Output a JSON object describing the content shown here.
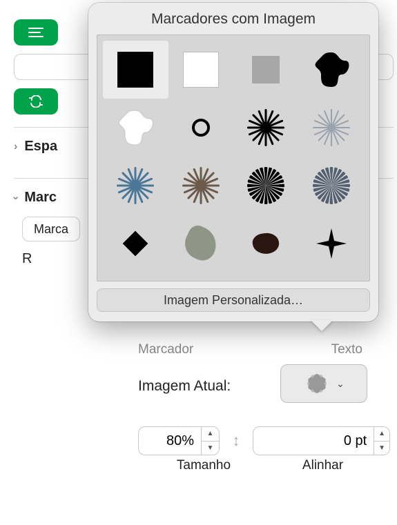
{
  "sidebar": {
    "spacing_label_partial": "Espa",
    "bullets_label_partial": "Marc",
    "bullet_type_partial": "Marca",
    "recent_partial": "R"
  },
  "popover": {
    "title": "Marcadores com Imagem",
    "custom_button": "Imagem Personalizada…"
  },
  "labels": {
    "marker": "Marcador",
    "text_partial": "Texto",
    "current_image": "Imagem Atual:",
    "size": "Tamanho",
    "align": "Alinhar"
  },
  "values": {
    "size_percent": "80%",
    "align_pt": "0 pt"
  }
}
